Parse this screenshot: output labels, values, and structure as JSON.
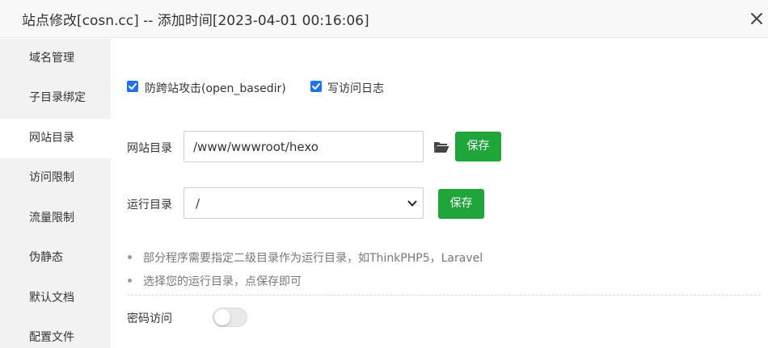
{
  "dialog": {
    "title": "站点修改[cosn.cc] -- 添加时间[2023-04-01 00:16:06]",
    "close_icon": "close-icon"
  },
  "sidebar": {
    "items": [
      {
        "label": "域名管理",
        "active": false
      },
      {
        "label": "子目录绑定",
        "active": false
      },
      {
        "label": "网站目录",
        "active": true
      },
      {
        "label": "访问限制",
        "active": false
      },
      {
        "label": "流量限制",
        "active": false
      },
      {
        "label": "伪静态",
        "active": false
      },
      {
        "label": "默认文档",
        "active": false
      },
      {
        "label": "配置文件",
        "active": false
      }
    ]
  },
  "options": {
    "anti_xss": {
      "label": "防跨站攻击(open_basedir)",
      "checked": true
    },
    "access_log": {
      "label": "写访问日志",
      "checked": true
    }
  },
  "site_dir": {
    "label": "网站目录",
    "value": "/www/wwwroot/hexo",
    "folder_icon": "folder-open-icon",
    "save_label": "保存"
  },
  "run_dir": {
    "label": "运行目录",
    "value": "/",
    "save_label": "保存"
  },
  "tips": [
    "部分程序需要指定二级目录作为运行目录，如ThinkPHP5，Laravel",
    "选择您的运行目录，点保存即可"
  ],
  "password_access": {
    "label": "密码访问",
    "enabled": false
  },
  "colors": {
    "primary_green": "#20a53a",
    "checkbox_blue": "#1e73e8",
    "sidebar_bg": "#f2f2f2"
  }
}
